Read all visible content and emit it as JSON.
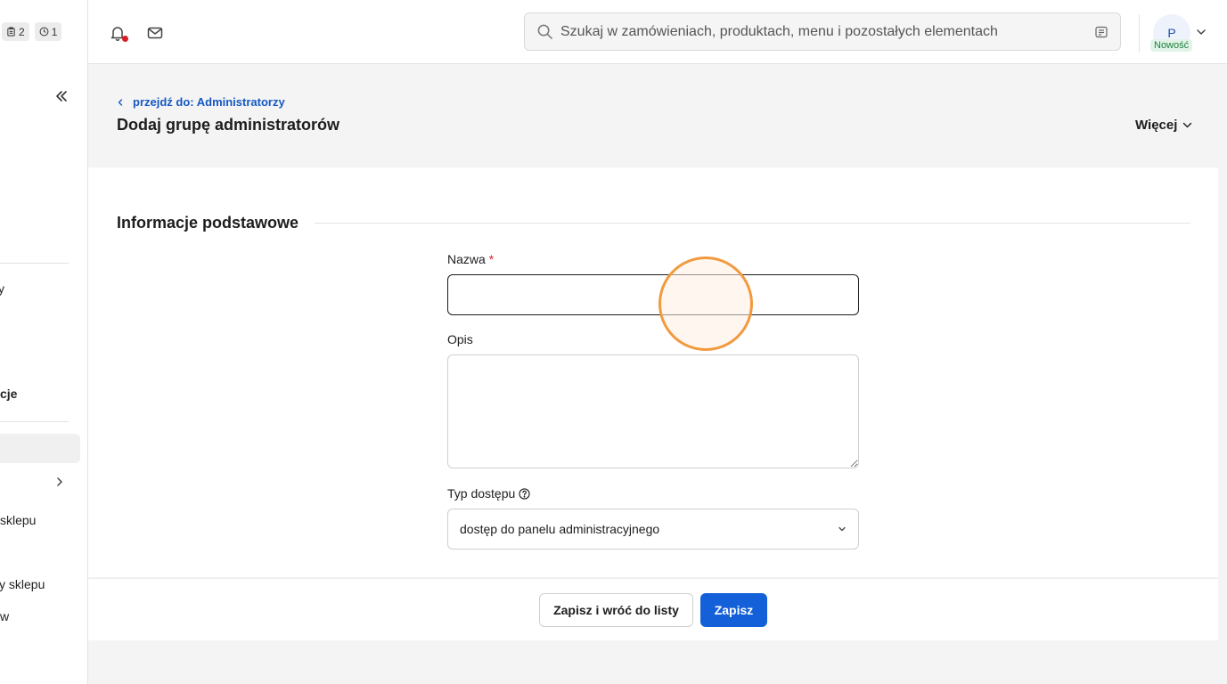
{
  "sidebar": {
    "badges": [
      {
        "icon": "clipboard-icon",
        "count": "2"
      },
      {
        "icon": "clock-icon",
        "count": "1"
      }
    ],
    "fragments": [
      {
        "text": "y",
        "bold": false
      },
      {
        "text": "cje",
        "bold": true
      },
      {
        "text": "sklepu",
        "bold": false
      },
      {
        "text": "y sklepu",
        "bold": false
      },
      {
        "text": " w",
        "bold": false
      }
    ]
  },
  "header": {
    "search_placeholder": "Szukaj w zamówieniach, produktach, menu i pozostałych elementach",
    "avatar_initial": "P",
    "avatar_tag": "Nowość"
  },
  "page": {
    "back_link": "przejdź do: Administratorzy",
    "title": "Dodaj grupę administratorów",
    "more_label": "Więcej"
  },
  "form": {
    "section_title": "Informacje podstawowe",
    "name_label": "Nazwa",
    "name_required_mark": "*",
    "name_value": "",
    "description_label": "Opis",
    "description_value": "",
    "access_type_label": "Typ dostępu",
    "access_type_selected": "dostęp do panelu administracyjnego"
  },
  "footer": {
    "save_and_back_label": "Zapisz i wróć do listy",
    "save_label": "Zapisz"
  },
  "colors": {
    "primary": "#1360d8",
    "link": "#1458c4",
    "required": "#d81f26",
    "new_tag_bg": "#e2f3e8",
    "new_tag_text": "#1a7f3c",
    "click_indicator": "#f19a3e"
  }
}
